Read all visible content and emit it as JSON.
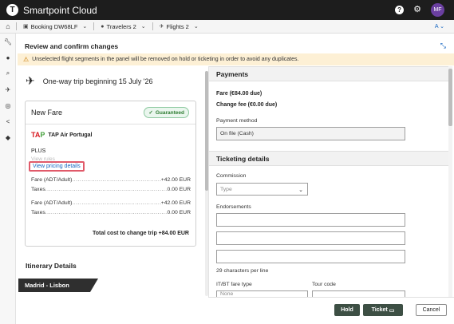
{
  "app": {
    "title": "Smartpoint Cloud",
    "logo_letter": "T",
    "user_initials": "MF"
  },
  "nav": {
    "booking_label": "Booking DW68LF",
    "travelers_label": "Travelers 2",
    "flights_label": "Flights 2",
    "language": "A"
  },
  "page": {
    "title": "Review and confirm changes",
    "warning": "Unselected flight segments in the panel will be removed on hold or ticketing in order to avoid any duplicates."
  },
  "trip": {
    "summary": "One-way trip beginning 15 July '26"
  },
  "fare_card": {
    "title": "New Fare",
    "badge": "Guaranteed",
    "airline_logo": "TAP",
    "airline": "TAP Air Portugal",
    "brand": "PLUS",
    "view_rules": "View rules",
    "view_pricing": "View pricing details",
    "lines": [
      {
        "label": "Fare (ADT/Adult)",
        "amount": "+42.00 EUR"
      },
      {
        "label": "Taxes",
        "amount": "0.00 EUR"
      },
      {
        "label": "Fare (ADT/Adult)",
        "amount": "+42.00 EUR"
      },
      {
        "label": "Taxes",
        "amount": "0.00 EUR"
      }
    ],
    "total": "Total cost to change trip +84.00 EUR"
  },
  "itinerary": {
    "title": "Itinerary Details",
    "route": "Madrid - Lisbon"
  },
  "payments": {
    "title": "Payments",
    "fare_due": "Fare (€84.00 due)",
    "change_fee": "Change fee (€0.00 due)",
    "method_label": "Payment method",
    "method_value": "On file (Cash)"
  },
  "ticketing": {
    "title": "Ticketing details",
    "commission_label": "Commission",
    "commission_placeholder": "Type",
    "endorsements_label": "Endorsements",
    "chars_hint": "29 characters per line",
    "it_bt_label": "IT/BT fare type",
    "it_bt_value": "None",
    "tour_code_label": "Tour code"
  },
  "footer": {
    "hold": "Hold",
    "ticket": "Ticket",
    "cancel": "Cancel"
  },
  "colors": {
    "primary_dark": "#3d4f44",
    "link": "#1565c0",
    "warning_bg": "#fdf0d5",
    "highlight": "#e05a6a",
    "avatar": "#6a3fa0"
  },
  "icons": [
    "home-icon",
    "help-icon",
    "gear-icon",
    "briefcase-icon",
    "person-icon",
    "plane-icon",
    "wrench-icon",
    "search-icon",
    "share-icon",
    "tag-icon",
    "warning-icon",
    "check-circle-icon",
    "collapse-icon",
    "ticket-icon",
    "chevron-down-icon"
  ]
}
